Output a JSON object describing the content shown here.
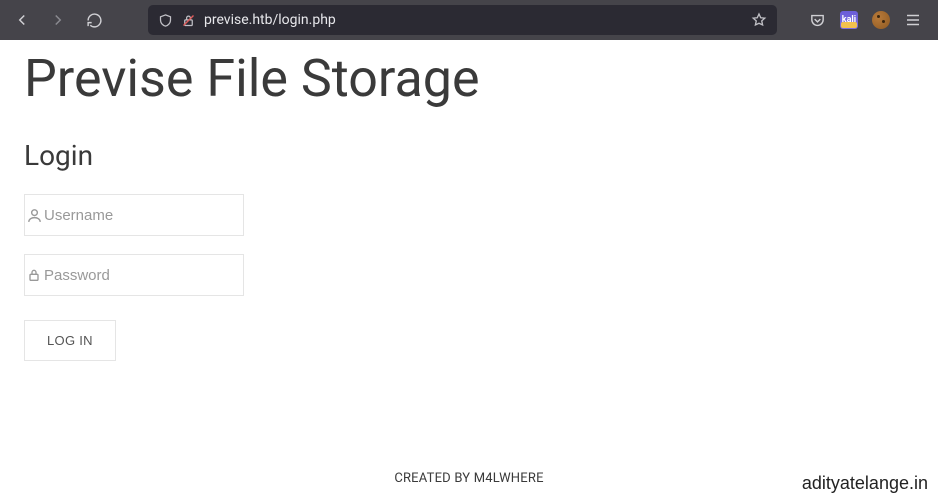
{
  "browser": {
    "url": "previse.htb/login.php",
    "extensions": {
      "kali_label": "kali"
    }
  },
  "page": {
    "title": "Previse File Storage",
    "login_heading": "Login",
    "username_placeholder": "Username",
    "password_placeholder": "Password",
    "login_button": "LOG IN",
    "footer": "CREATED BY M4LWHERE"
  },
  "watermark": "adityatelange.in"
}
